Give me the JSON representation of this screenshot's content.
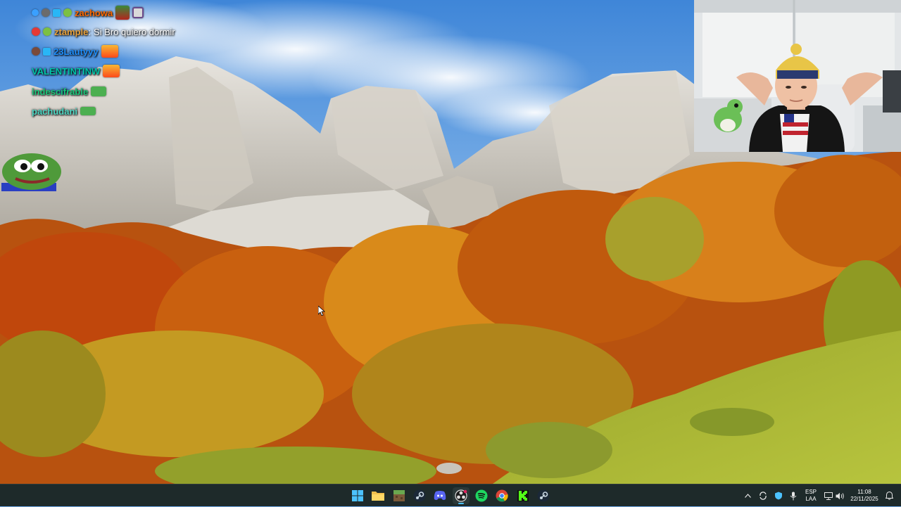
{
  "chat": {
    "messages": [
      {
        "username": "zachowa",
        "text": "",
        "color": "#ff6a00"
      },
      {
        "username": "ztample",
        "text": "Si Bro quiero dormir",
        "color": "#e9a23b"
      },
      {
        "username": "23Lautyyy",
        "text": "",
        "color": "#1e90ff"
      },
      {
        "username": "VALENTINTINW",
        "text": "",
        "color": "#00c4a7"
      },
      {
        "username": "indescifrable",
        "text": "",
        "color": "#19c77a"
      },
      {
        "username": "pachudani",
        "text": "",
        "color": "#4dd6c2"
      }
    ],
    "separator": ":"
  },
  "taskbar": {
    "apps": [
      {
        "name": "windows-start-icon"
      },
      {
        "name": "file-explorer-icon"
      },
      {
        "name": "minecraft-icon"
      },
      {
        "name": "steam-icon"
      },
      {
        "name": "discord-icon"
      },
      {
        "name": "obs-studio-icon"
      },
      {
        "name": "spotify-icon"
      },
      {
        "name": "chrome-icon"
      },
      {
        "name": "kick-icon"
      },
      {
        "name": "steam-icon"
      }
    ],
    "tray": {
      "language_top": "ESP",
      "language_bottom": "LAA",
      "time": "11:08",
      "date": "22/11/2025"
    }
  },
  "cursor": {
    "icon": "mouse-pointer-icon"
  }
}
